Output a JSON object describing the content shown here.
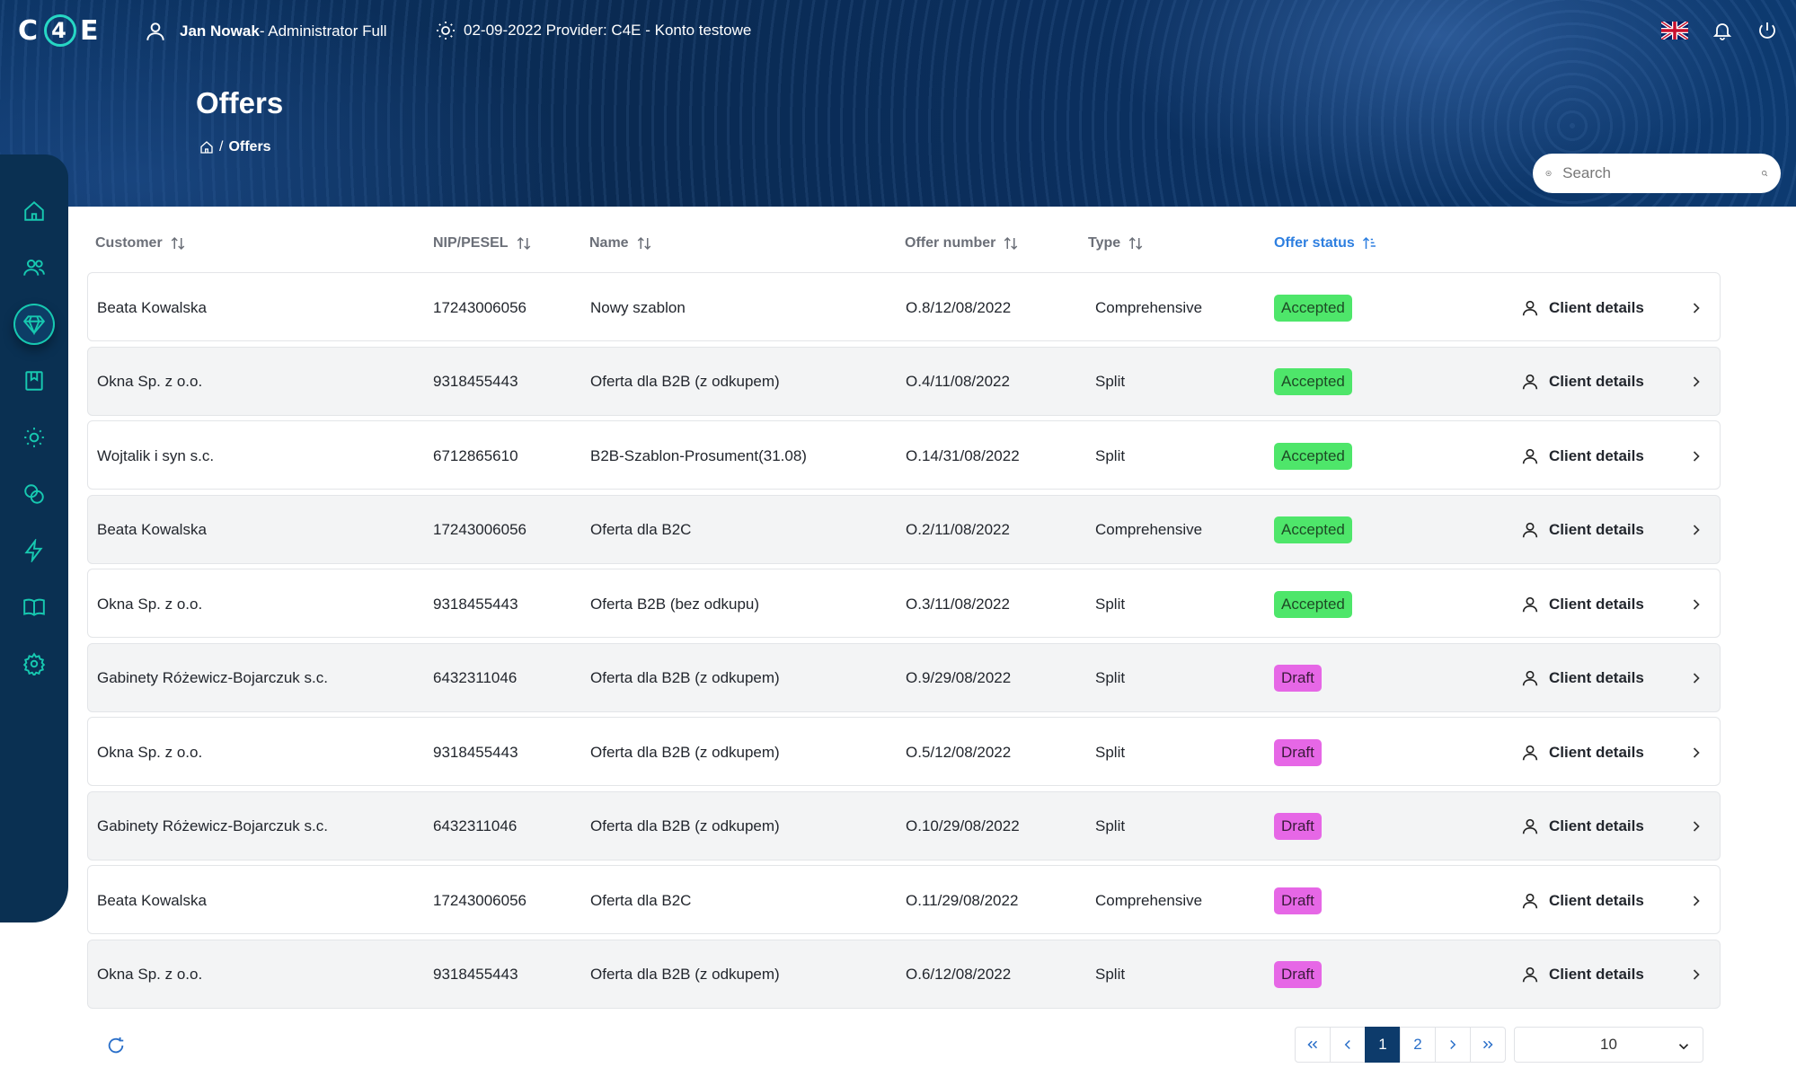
{
  "app": {
    "logo_text_left": "C",
    "logo_text_ring": "4",
    "logo_text_right": "E"
  },
  "topbar": {
    "user_name": "Jan Nowak",
    "user_role": "- Administrator Full",
    "date_provider": "02-09-2022 Provider: C4E - Konto testowe"
  },
  "page": {
    "title": "Offers",
    "breadcrumb_sep": "/",
    "breadcrumb_current": "Offers"
  },
  "search": {
    "placeholder": "Search"
  },
  "sidebar": {
    "items": [
      {
        "name": "home-icon"
      },
      {
        "name": "users-icon"
      },
      {
        "name": "diamond-icon"
      },
      {
        "name": "bookmark-icon"
      },
      {
        "name": "sun-icon"
      },
      {
        "name": "coins-icon"
      },
      {
        "name": "lightning-icon"
      },
      {
        "name": "book-icon"
      },
      {
        "name": "gear-icon"
      }
    ],
    "active_index": 2
  },
  "table": {
    "columns": {
      "customer": "Customer",
      "nip": "NIP/PESEL",
      "name": "Name",
      "offer_number": "Offer number",
      "type": "Type",
      "offer_status": "Offer status"
    },
    "action_label": "Client details",
    "rows": [
      {
        "customer": "Beata Kowalska",
        "nip": "17243006056",
        "name": "Nowy szablon",
        "offer_number": "O.8/12/08/2022",
        "type": "Comprehensive",
        "status": "Accepted"
      },
      {
        "customer": "Okna Sp. z o.o.",
        "nip": "9318455443",
        "name": "Oferta dla B2B (z odkupem)",
        "offer_number": "O.4/11/08/2022",
        "type": "Split",
        "status": "Accepted"
      },
      {
        "customer": "Wojtalik i syn s.c.",
        "nip": "6712865610",
        "name": "B2B-Szablon-Prosument(31.08)",
        "offer_number": "O.14/31/08/2022",
        "type": "Split",
        "status": "Accepted"
      },
      {
        "customer": "Beata Kowalska",
        "nip": "17243006056",
        "name": "Oferta dla B2C",
        "offer_number": "O.2/11/08/2022",
        "type": "Comprehensive",
        "status": "Accepted"
      },
      {
        "customer": "Okna Sp. z o.o.",
        "nip": "9318455443",
        "name": "Oferta B2B (bez odkupu)",
        "offer_number": "O.3/11/08/2022",
        "type": "Split",
        "status": "Accepted"
      },
      {
        "customer": "Gabinety Różewicz-Bojarczuk s.c.",
        "nip": "6432311046",
        "name": "Oferta dla B2B (z odkupem)",
        "offer_number": "O.9/29/08/2022",
        "type": "Split",
        "status": "Draft"
      },
      {
        "customer": "Okna Sp. z o.o.",
        "nip": "9318455443",
        "name": "Oferta dla B2B (z odkupem)",
        "offer_number": "O.5/12/08/2022",
        "type": "Split",
        "status": "Draft"
      },
      {
        "customer": "Gabinety Różewicz-Bojarczuk s.c.",
        "nip": "6432311046",
        "name": "Oferta dla B2B (z odkupem)",
        "offer_number": "O.10/29/08/2022",
        "type": "Split",
        "status": "Draft"
      },
      {
        "customer": "Beata Kowalska",
        "nip": "17243006056",
        "name": "Oferta dla B2C",
        "offer_number": "O.11/29/08/2022",
        "type": "Comprehensive",
        "status": "Draft"
      },
      {
        "customer": "Okna Sp. z o.o.",
        "nip": "9318455443",
        "name": "Oferta dla B2B (z odkupem)",
        "offer_number": "O.6/12/08/2022",
        "type": "Split",
        "status": "Draft"
      }
    ]
  },
  "pagination": {
    "pages": [
      "1",
      "2"
    ],
    "current": "1",
    "page_size": "10"
  },
  "colors": {
    "accent": "#2e7fe0",
    "accepted": "#4ee66a",
    "draft": "#e667e6",
    "nav_bg": "#0a3052"
  }
}
